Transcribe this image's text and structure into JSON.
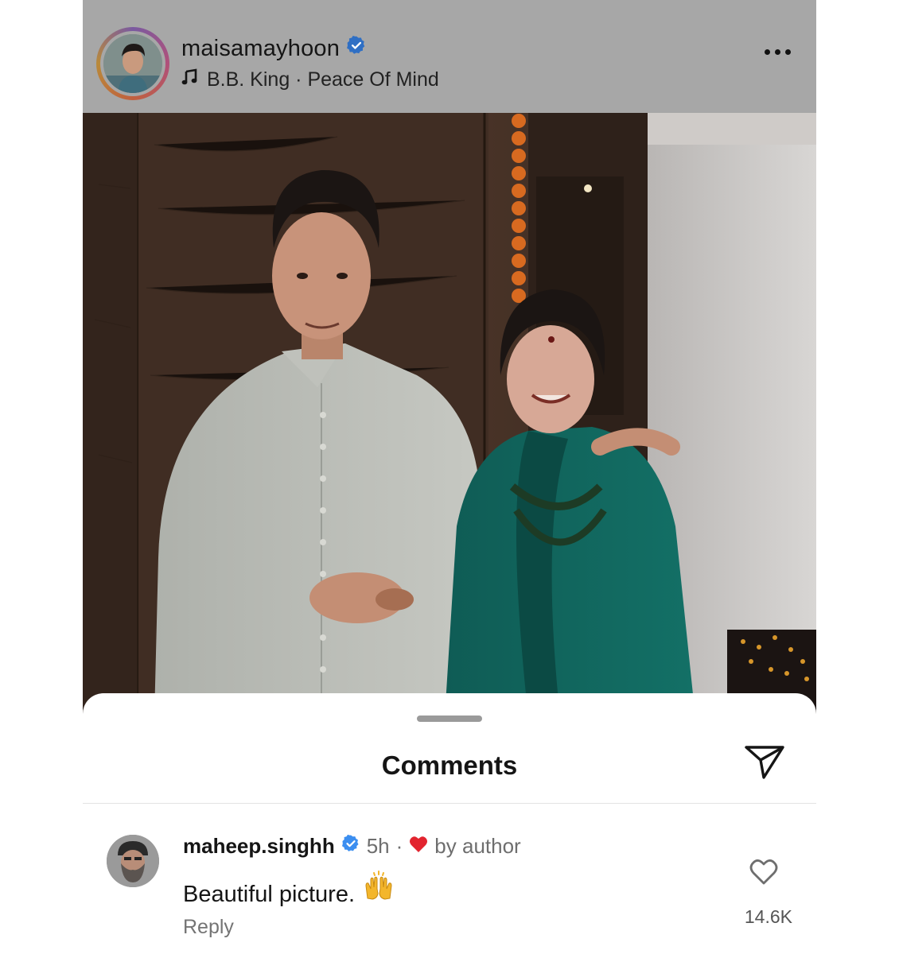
{
  "post_header": {
    "username": "maisamayhoon",
    "verified": true,
    "music": "B.B. King · Peace Of Mind",
    "icons": {
      "music": "music-note-icon",
      "more": "more-horizontal-icon",
      "verified": "verified-badge-icon"
    }
  },
  "photo": {
    "alt_subject": "photo-post"
  },
  "comments_sheet": {
    "title": "Comments",
    "share_icon": "send-icon",
    "comment": {
      "username": "maheep.singhh",
      "verified": true,
      "time": "5h",
      "separator": "·",
      "liked_by": "by author",
      "text": "Beautiful picture.",
      "emoji": "raising-hands-emoji",
      "reply_label": "Reply",
      "like_count": "14.6K"
    }
  },
  "colors": {
    "header_dim": "#a7a7a7",
    "verified_blue": "#3b8ef0",
    "heart_red": "#e2242f",
    "muted_text": "#6e6e6e"
  }
}
